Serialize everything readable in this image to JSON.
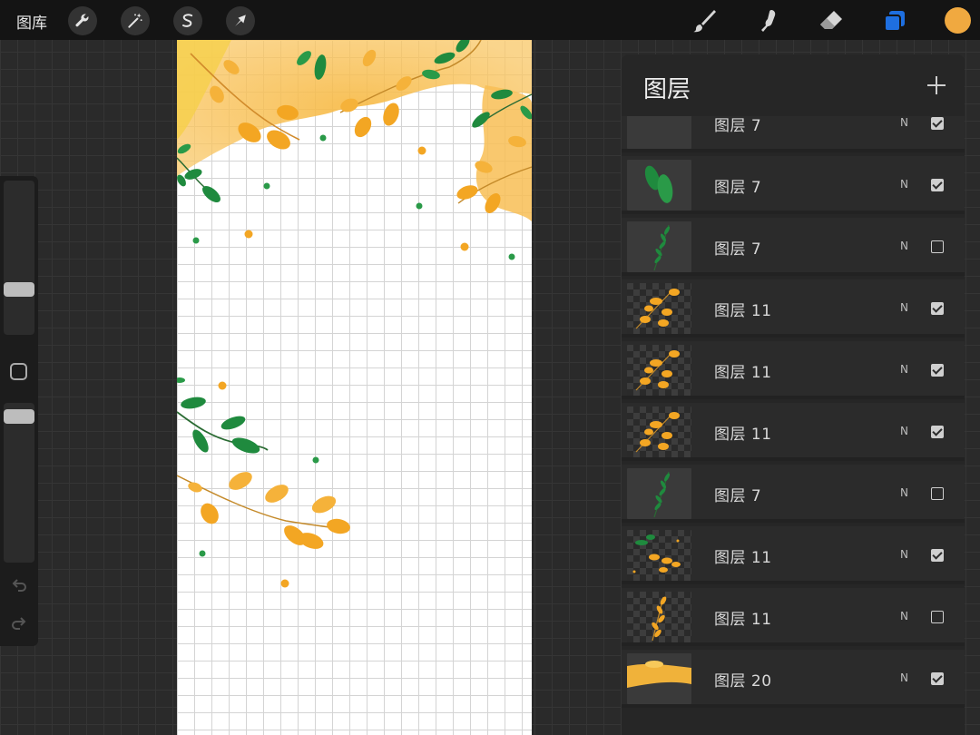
{
  "topbar": {
    "gallery_label": "图库",
    "tools_left": [
      "wrench-icon",
      "magic-wand-icon",
      "selection-icon",
      "transform-arrow-icon"
    ],
    "tools_right": [
      "brush-icon",
      "smudge-icon",
      "eraser-icon",
      "layers-icon"
    ],
    "active_color": "#f0a940",
    "accent_color": "#1e6fe0"
  },
  "sidebar": {
    "brush_size_level": 0.72,
    "opacity_level": 0.95
  },
  "canvas": {
    "background": "#ffffff",
    "leaf_orange": "#f3a623",
    "leaf_green": "#1f8a3e"
  },
  "layers_panel": {
    "title": "图层",
    "layers": [
      {
        "name": "图层 7",
        "blend": "N",
        "visible": true,
        "thumb": "green-partial"
      },
      {
        "name": "图层 7",
        "blend": "N",
        "visible": true,
        "thumb": "green-leaves"
      },
      {
        "name": "图层 7",
        "blend": "N",
        "visible": false,
        "thumb": "green-sprig"
      },
      {
        "name": "图层 11",
        "blend": "N",
        "visible": true,
        "thumb": "orange-branch"
      },
      {
        "name": "图层 11",
        "blend": "N",
        "visible": true,
        "thumb": "orange-branch"
      },
      {
        "name": "图层 11",
        "blend": "N",
        "visible": true,
        "thumb": "orange-branch"
      },
      {
        "name": "图层 7",
        "blend": "N",
        "visible": false,
        "thumb": "green-sprig"
      },
      {
        "name": "图层 11",
        "blend": "N",
        "visible": true,
        "thumb": "mixed-branch"
      },
      {
        "name": "图层 11",
        "blend": "N",
        "visible": false,
        "thumb": "orange-sprig"
      },
      {
        "name": "图层 20",
        "blend": "N",
        "visible": true,
        "thumb": "orange-wash"
      }
    ]
  }
}
